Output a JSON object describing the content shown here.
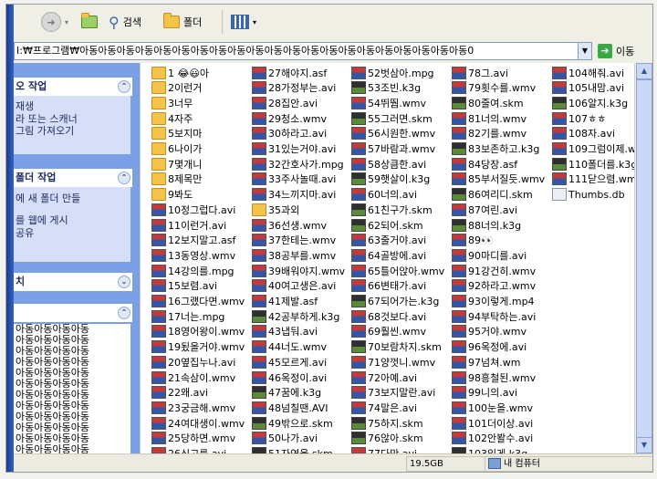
{
  "toolbar": {
    "back_label": "",
    "search_label": "검색",
    "folder_label": "폴더"
  },
  "address": {
    "path": "I:₩프로그램₩아동아동아동아동아동아동아동아동아동아동아동아동아동아동아동아동아동아동아동아동아동0",
    "go_label": "이동"
  },
  "taskpane": {
    "section1": {
      "title": "오 작업",
      "items": [
        "재생",
        "라 또는 스캐너",
        "그림 가져오기"
      ]
    },
    "section2": {
      "title": "폴더 작업",
      "items": [
        "에 새 폴더 만들",
        "를 웹에 게시",
        "공유"
      ]
    },
    "section3": {
      "title": "치"
    },
    "section4": {
      "title": "",
      "repeated_text": "아동아동아동아동"
    }
  },
  "files": {
    "col1": [
      {
        "name": "1 😂😃아",
        "type": "folder"
      },
      {
        "name": "2이런거",
        "type": "folder"
      },
      {
        "name": "3너무",
        "type": "folder"
      },
      {
        "name": "4자주",
        "type": "folder"
      },
      {
        "name": "5보지마",
        "type": "folder"
      },
      {
        "name": "6나이가",
        "type": "folder"
      },
      {
        "name": "7몇개니",
        "type": "folder"
      },
      {
        "name": "8제목만",
        "type": "folder"
      },
      {
        "name": "9봐도",
        "type": "folder"
      },
      {
        "name": "10정그럽다.avi",
        "type": "video"
      },
      {
        "name": "11이런거.avi",
        "type": "video"
      },
      {
        "name": "12보지말고.asf",
        "type": "video"
      },
      {
        "name": "13동영상.wmv",
        "type": "video"
      },
      {
        "name": "14강의를.mpg",
        "type": "video"
      },
      {
        "name": "15보렴.avi",
        "type": "video"
      },
      {
        "name": "16그랬다면.wmv",
        "type": "video"
      },
      {
        "name": "17너는.mpg",
        "type": "video"
      },
      {
        "name": "18영어왕이.wmv",
        "type": "video"
      },
      {
        "name": "19됬을거야.wmv",
        "type": "video"
      },
      {
        "name": "20옆집누나.avi",
        "type": "video"
      },
      {
        "name": "21속삼이.wmv",
        "type": "video"
      },
      {
        "name": "22왜.avi",
        "type": "video"
      },
      {
        "name": "23궁금해.wmv",
        "type": "video"
      },
      {
        "name": "24여대생이.wmv",
        "type": "video"
      },
      {
        "name": "25당하면.wmv",
        "type": "video"
      },
      {
        "name": "26신고를.avi",
        "type": "video"
      }
    ],
    "col2": [
      {
        "name": "27해야지.asf",
        "type": "video"
      },
      {
        "name": "28가정부는.avi",
        "type": "video"
      },
      {
        "name": "28집안.avi",
        "type": "video"
      },
      {
        "name": "29청소.wmv",
        "type": "video"
      },
      {
        "name": "30하라고.avi",
        "type": "video"
      },
      {
        "name": "31있는거야.avi",
        "type": "video"
      },
      {
        "name": "32간호사가.mpg",
        "type": "video"
      },
      {
        "name": "33주사놀때.avi",
        "type": "video"
      },
      {
        "name": "34느끼지마.avi",
        "type": "video"
      },
      {
        "name": "35과외",
        "type": "folder"
      },
      {
        "name": "36선생.wmv",
        "type": "video"
      },
      {
        "name": "37한테는.wmv",
        "type": "video"
      },
      {
        "name": "38공부를.wmv",
        "type": "video"
      },
      {
        "name": "39배워야지.wmv",
        "type": "video"
      },
      {
        "name": "40여고생은.avi",
        "type": "video"
      },
      {
        "name": "41제발.asf",
        "type": "video"
      },
      {
        "name": "42공부하게.k3g",
        "type": "k3g"
      },
      {
        "name": "43냅둬.avi",
        "type": "video"
      },
      {
        "name": "44너도.wmv",
        "type": "video"
      },
      {
        "name": "45모르게.avi",
        "type": "video"
      },
      {
        "name": "46옥정이.avi",
        "type": "video"
      },
      {
        "name": "47꿈에.k3g",
        "type": "k3g"
      },
      {
        "name": "48넘칠땐.AVI",
        "type": "video"
      },
      {
        "name": "49밖으로.skm",
        "type": "k3g"
      },
      {
        "name": "50나가.avi",
        "type": "video"
      },
      {
        "name": "51자연을.skm",
        "type": "k3g"
      }
    ],
    "col3": [
      {
        "name": "52벗삼아.mpg",
        "type": "video"
      },
      {
        "name": "53조빈.k3g",
        "type": "k3g"
      },
      {
        "name": "54뛰뛈.wmv",
        "type": "video"
      },
      {
        "name": "55그러면.skm",
        "type": "k3g"
      },
      {
        "name": "56시원한.wmv",
        "type": "video"
      },
      {
        "name": "57바람과.wmv",
        "type": "video"
      },
      {
        "name": "58상큼한.avi",
        "type": "video"
      },
      {
        "name": "59햇살이.k3g",
        "type": "k3g"
      },
      {
        "name": "60너의.avi",
        "type": "video"
      },
      {
        "name": "61친구가.skm",
        "type": "k3g"
      },
      {
        "name": "62되어.skm",
        "type": "k3g"
      },
      {
        "name": "63줄거야.avi",
        "type": "video"
      },
      {
        "name": "64골방에.avi",
        "type": "video"
      },
      {
        "name": "65틀어앉아.wmv",
        "type": "video"
      },
      {
        "name": "66변태가.avi",
        "type": "video"
      },
      {
        "name": "67되어가는.k3g",
        "type": "k3g"
      },
      {
        "name": "68것보다.avi",
        "type": "video"
      },
      {
        "name": "69훨씬.wmv",
        "type": "video"
      },
      {
        "name": "70보람차지.skm",
        "type": "k3g"
      },
      {
        "name": "71양껏니.wmv",
        "type": "video"
      },
      {
        "name": "72아예.avi",
        "type": "video"
      },
      {
        "name": "73보지말란.avi",
        "type": "video"
      },
      {
        "name": "74말은.avi",
        "type": "video"
      },
      {
        "name": "75하지.skm",
        "type": "k3g"
      },
      {
        "name": "76않아.skm",
        "type": "k3g"
      },
      {
        "name": "77다만.avi",
        "type": "video"
      }
    ],
    "col4": [
      {
        "name": "78그.avi",
        "type": "video"
      },
      {
        "name": "79횟수를.wmv",
        "type": "video"
      },
      {
        "name": "80줄여.skm",
        "type": "k3g"
      },
      {
        "name": "81너의.wmv",
        "type": "video"
      },
      {
        "name": "82기를.wmv",
        "type": "video"
      },
      {
        "name": "83보존하고.k3g",
        "type": "k3g"
      },
      {
        "name": "84당장.asf",
        "type": "video"
      },
      {
        "name": "85부서질듯.wmv",
        "type": "video"
      },
      {
        "name": "86여리디.skm",
        "type": "k3g"
      },
      {
        "name": "87여린.avi",
        "type": "video"
      },
      {
        "name": "88너의.k3g",
        "type": "k3g"
      },
      {
        "name": "89👀",
        "type": "video"
      },
      {
        "name": "90마디를.avi",
        "type": "video"
      },
      {
        "name": "91강건히.wmv",
        "type": "video"
      },
      {
        "name": "92하라고.wmv",
        "type": "video"
      },
      {
        "name": "93이렇게.mp4",
        "type": "video"
      },
      {
        "name": "94부탁하는.avi",
        "type": "video"
      },
      {
        "name": "95거야.wmv",
        "type": "video"
      },
      {
        "name": "96옥정에.avi",
        "type": "video"
      },
      {
        "name": "97넘쳐.wm",
        "type": "video"
      },
      {
        "name": "98흥철된.wmv",
        "type": "video"
      },
      {
        "name": "99니의.avi",
        "type": "video"
      },
      {
        "name": "100눈을.wmv",
        "type": "video"
      },
      {
        "name": "101더이상.avi",
        "type": "video"
      },
      {
        "name": "102안봘수.avi",
        "type": "video"
      },
      {
        "name": "103있게.k3g",
        "type": "k3g"
      }
    ],
    "col5": [
      {
        "name": "104해줘.avi",
        "type": "video"
      },
      {
        "name": "105내맘.avi",
        "type": "video"
      },
      {
        "name": "106알지.k3g",
        "type": "k3g"
      },
      {
        "name": "107ㅎㅎ",
        "type": "video"
      },
      {
        "name": "108자.avi",
        "type": "video"
      },
      {
        "name": "109그럼이제.wmv",
        "type": "video"
      },
      {
        "name": "110폴더를.k3g",
        "type": "k3g"
      },
      {
        "name": "111닫으렴.wmv",
        "type": "video"
      },
      {
        "name": "Thumbs.db",
        "type": "db"
      }
    ]
  },
  "status": {
    "size": "19.5GB",
    "location": "내 컴퓨터"
  }
}
